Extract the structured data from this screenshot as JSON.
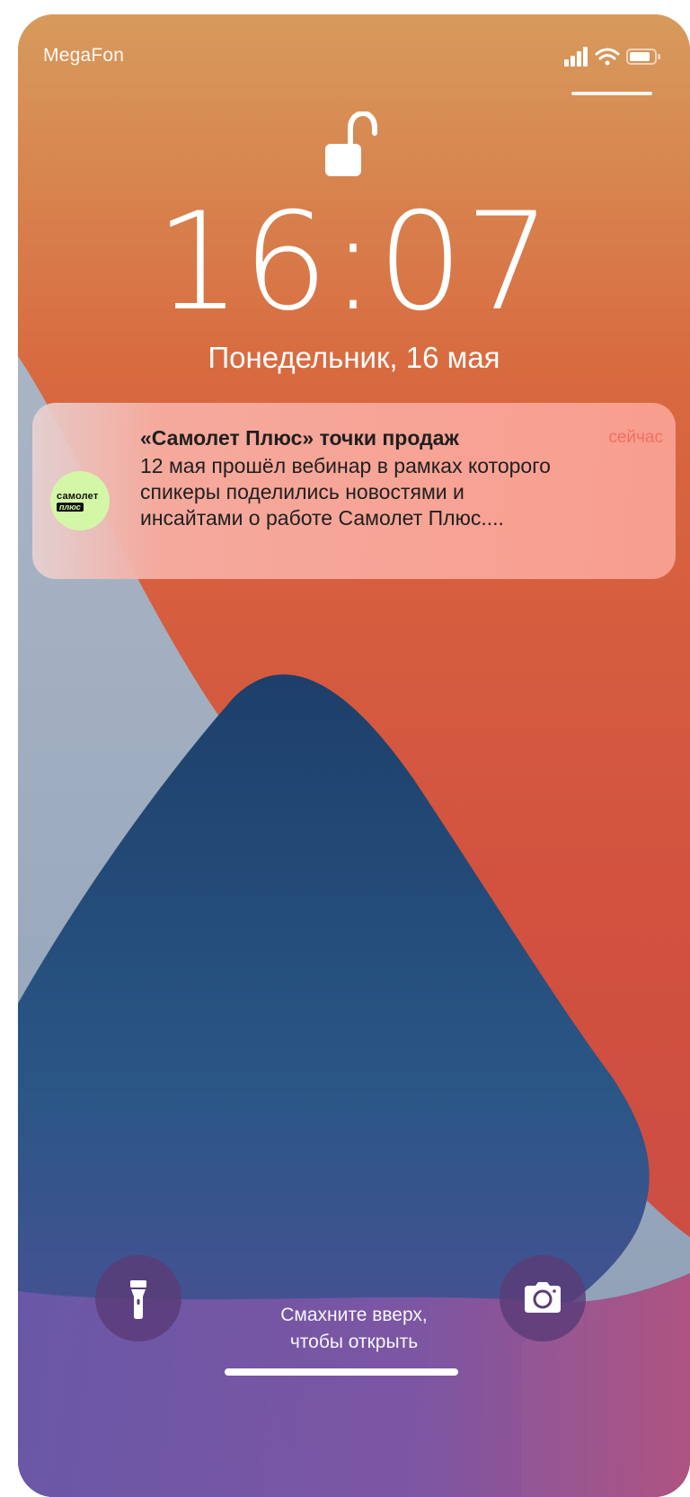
{
  "status_bar": {
    "carrier": "MegaFon",
    "icons": [
      "signal-icon",
      "wifi-icon",
      "battery-icon"
    ]
  },
  "lock_screen": {
    "lock_icon": "unlocked-padlock-icon",
    "time": "16:07",
    "date": "Понедельник, 16 мая"
  },
  "notification": {
    "app_icon_text_line1": "самолет",
    "app_icon_text_line2": "плюс",
    "title": "«Самолет Плюс» точки продаж",
    "time": "сейчас",
    "body_lines": [
      "12 мая прошёл вебинар в рамках которого",
      "спикеры поделились новостями и",
      "инсайтами о работе Самолет Плюс...."
    ]
  },
  "bottom": {
    "flashlight_icon": "flashlight-icon",
    "camera_icon": "camera-icon",
    "swipe_line1": "Смахните вверх,",
    "swipe_line2": "чтобы открыть"
  },
  "colors": {
    "wallpaper_orange": "#d8593c",
    "wallpaper_red": "#c84a45",
    "wallpaper_blue": "#2a5a8a",
    "wallpaper_grey": "#9fb0c4",
    "notification_time": "#f36f5f",
    "app_icon_green": "#d3f7a7"
  }
}
